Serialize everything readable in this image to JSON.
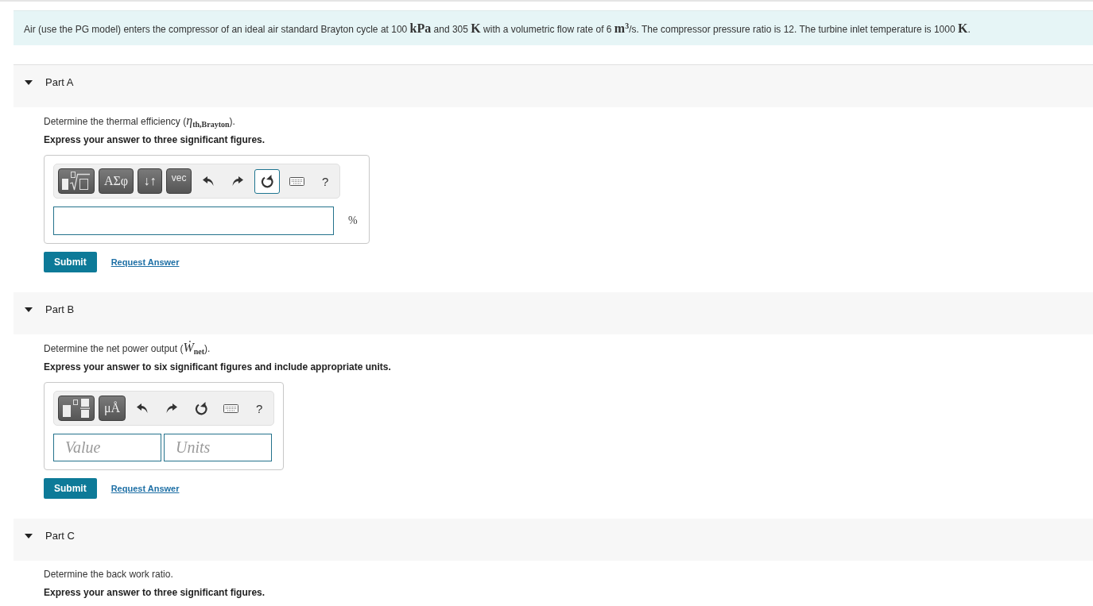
{
  "problem": {
    "text": "Air (use the PG model) enters the compressor of an ideal air standard Brayton cycle at 100 **kPa** and 305 **K** with a volumetric flow rate of 6 **m**$^{3}$/s. The compressor pressure ratio is 12. The turbine inlet temperature is 1000 **K**."
  },
  "parts": [
    {
      "title": "Part A",
      "expanded": true,
      "question": "Determine the thermal efficiency (*η*$_{th,Brayton}$).",
      "instruction": "Express your answer to three significant figures.",
      "answer": {
        "kind": "single",
        "toolbar": [
          {
            "kind": "root-template",
            "focused": false
          },
          {
            "kind": "symbols",
            "label": "ΑΣφ",
            "focused": false
          },
          {
            "kind": "symbols",
            "label": "↓↑",
            "focused": false
          },
          {
            "kind": "text",
            "label": "vec",
            "focused": false
          },
          {
            "kind": "undo",
            "focused": false
          },
          {
            "kind": "redo",
            "focused": false
          },
          {
            "kind": "reset",
            "focused": true
          },
          {
            "kind": "keyboard",
            "focused": false
          },
          {
            "kind": "help",
            "label": "?",
            "focused": false
          }
        ],
        "unit": "%"
      },
      "submit": "Submit",
      "request": "Request Answer"
    },
    {
      "title": "Part B",
      "expanded": true,
      "question": "Determine the net power output (*Ẇ*$_{net}$).",
      "instruction": "Express your answer to six significant figures and include appropriate units.",
      "answer": {
        "kind": "value_units",
        "toolbar": [
          {
            "kind": "fraction-template",
            "focused": false
          },
          {
            "kind": "symbols",
            "label": "μÅ",
            "focused": false
          },
          {
            "kind": "undo",
            "focused": false
          },
          {
            "kind": "redo",
            "focused": false
          },
          {
            "kind": "reset",
            "focused": false
          },
          {
            "kind": "keyboard",
            "focused": false
          },
          {
            "kind": "help",
            "label": "?",
            "focused": false
          }
        ],
        "fields": [
          {
            "placeholder": "Value"
          },
          {
            "placeholder": "Units"
          }
        ]
      },
      "submit": "Submit",
      "request": "Request Answer"
    },
    {
      "title": "Part C",
      "expanded": true,
      "question": "Determine the back work ratio.",
      "instruction": "Express your answer to three significant figures."
    }
  ]
}
